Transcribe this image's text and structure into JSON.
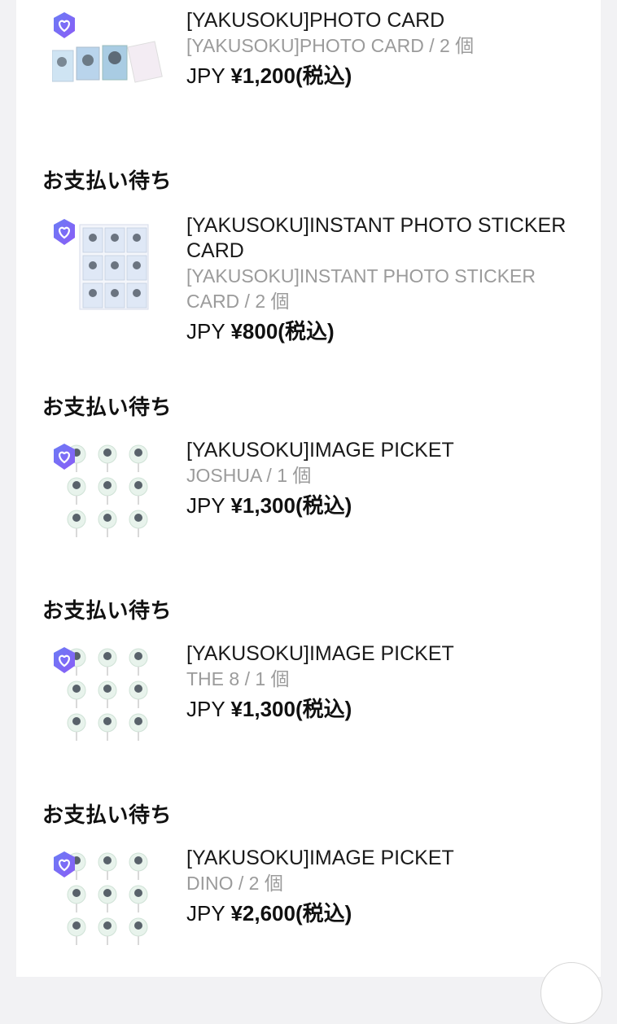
{
  "status_label": "お支払い待ち",
  "currency_prefix": "JPY",
  "orders": [
    {
      "status": "",
      "name": "[YAKUSOKU]PHOTO CARD",
      "option": "[YAKUSOKU]PHOTO CARD / 2 個",
      "price": "¥1,200(税込)"
    },
    {
      "status": "お支払い待ち",
      "name": "[YAKUSOKU]INSTANT PHOTO STICKER CARD",
      "option": "[YAKUSOKU]INSTANT PHOTO STICKER CARD / 2 個",
      "price": "¥800(税込)"
    },
    {
      "status": "お支払い待ち",
      "name": "[YAKUSOKU]IMAGE PICKET",
      "option": "JOSHUA / 1 個",
      "price": "¥1,300(税込)"
    },
    {
      "status": "お支払い待ち",
      "name": "[YAKUSOKU]IMAGE PICKET",
      "option": "THE 8 / 1 個",
      "price": "¥1,300(税込)"
    },
    {
      "status": "お支払い待ち",
      "name": "[YAKUSOKU]IMAGE PICKET",
      "option": "DINO / 2 個",
      "price": "¥2,600(税込)"
    }
  ],
  "colors": {
    "badge_gradient_start": "#6a7cf5",
    "badge_gradient_end": "#8b5cf6",
    "option_text": "#9b9b9b",
    "page_bg": "#f2f2f4"
  },
  "icons": {
    "badge": "shield-heart-icon",
    "scroll": "scroll-top-button"
  }
}
